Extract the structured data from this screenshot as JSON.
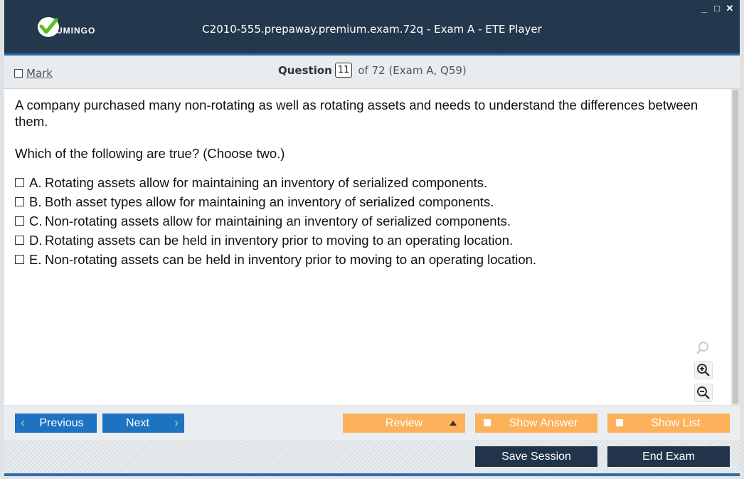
{
  "window": {
    "title": "C2010-555.prepaway.premium.exam.72q - Exam A - ETE Player",
    "logo_text": "UMINGO",
    "controls": {
      "minimize": "_",
      "maximize": "□",
      "close": "✕"
    }
  },
  "header": {
    "mark_label": "Mark",
    "question_label": "Question",
    "question_number": "11",
    "question_of": "of 72 (Exam A, Q59)"
  },
  "question": {
    "text": "A company purchased many non-rotating as well as rotating assets and needs to understand the differences between them.",
    "prompt": "Which of the following are true? (Choose two.)",
    "answers": [
      {
        "letter": "A.",
        "text": "Rotating assets allow for maintaining an inventory of serialized components."
      },
      {
        "letter": "B.",
        "text": "Both asset types allow for maintaining an inventory of serialized components."
      },
      {
        "letter": "C.",
        "text": "Non-rotating assets allow for maintaining an inventory of serialized components."
      },
      {
        "letter": "D.",
        "text": "Rotating assets can be held in inventory prior to moving to an operating location."
      },
      {
        "letter": "E.",
        "text": "Non-rotating assets can be held in inventory prior to moving to an operating location."
      }
    ]
  },
  "zoom": {
    "icons": [
      "search-icon",
      "zoom-in-icon",
      "zoom-out-icon"
    ]
  },
  "nav": {
    "previous": "Previous",
    "next": "Next",
    "review": "Review",
    "show_answer": "Show Answer",
    "show_list": "Show List",
    "save_session": "Save Session",
    "end_exam": "End Exam"
  },
  "colors": {
    "title_bg": "#23384d",
    "accent_blue": "#1e72c2",
    "orange": "#fdb15a",
    "dark_button": "#22344a",
    "logo_green": "#5bbf21"
  }
}
